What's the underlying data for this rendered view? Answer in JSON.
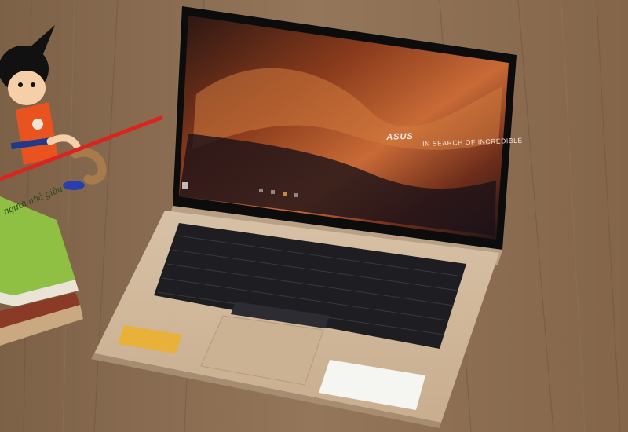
{
  "photo": {
    "subject": "laptop-on-wooden-table",
    "wallpaper_tagline": "IN SEARCH OF INCREDIBLE",
    "logo_text": "ASUS",
    "book_title": "ngươi nhà giàu",
    "colors": {
      "table": "#8a6a4c",
      "laptop_body": "#d9c2a6",
      "keyboard": "#1e1e22",
      "screen_dark": "#141416",
      "wallpaper_orange": "#b0552a",
      "book_green": "#8fc043",
      "figure_orange": "#e8531f"
    }
  }
}
